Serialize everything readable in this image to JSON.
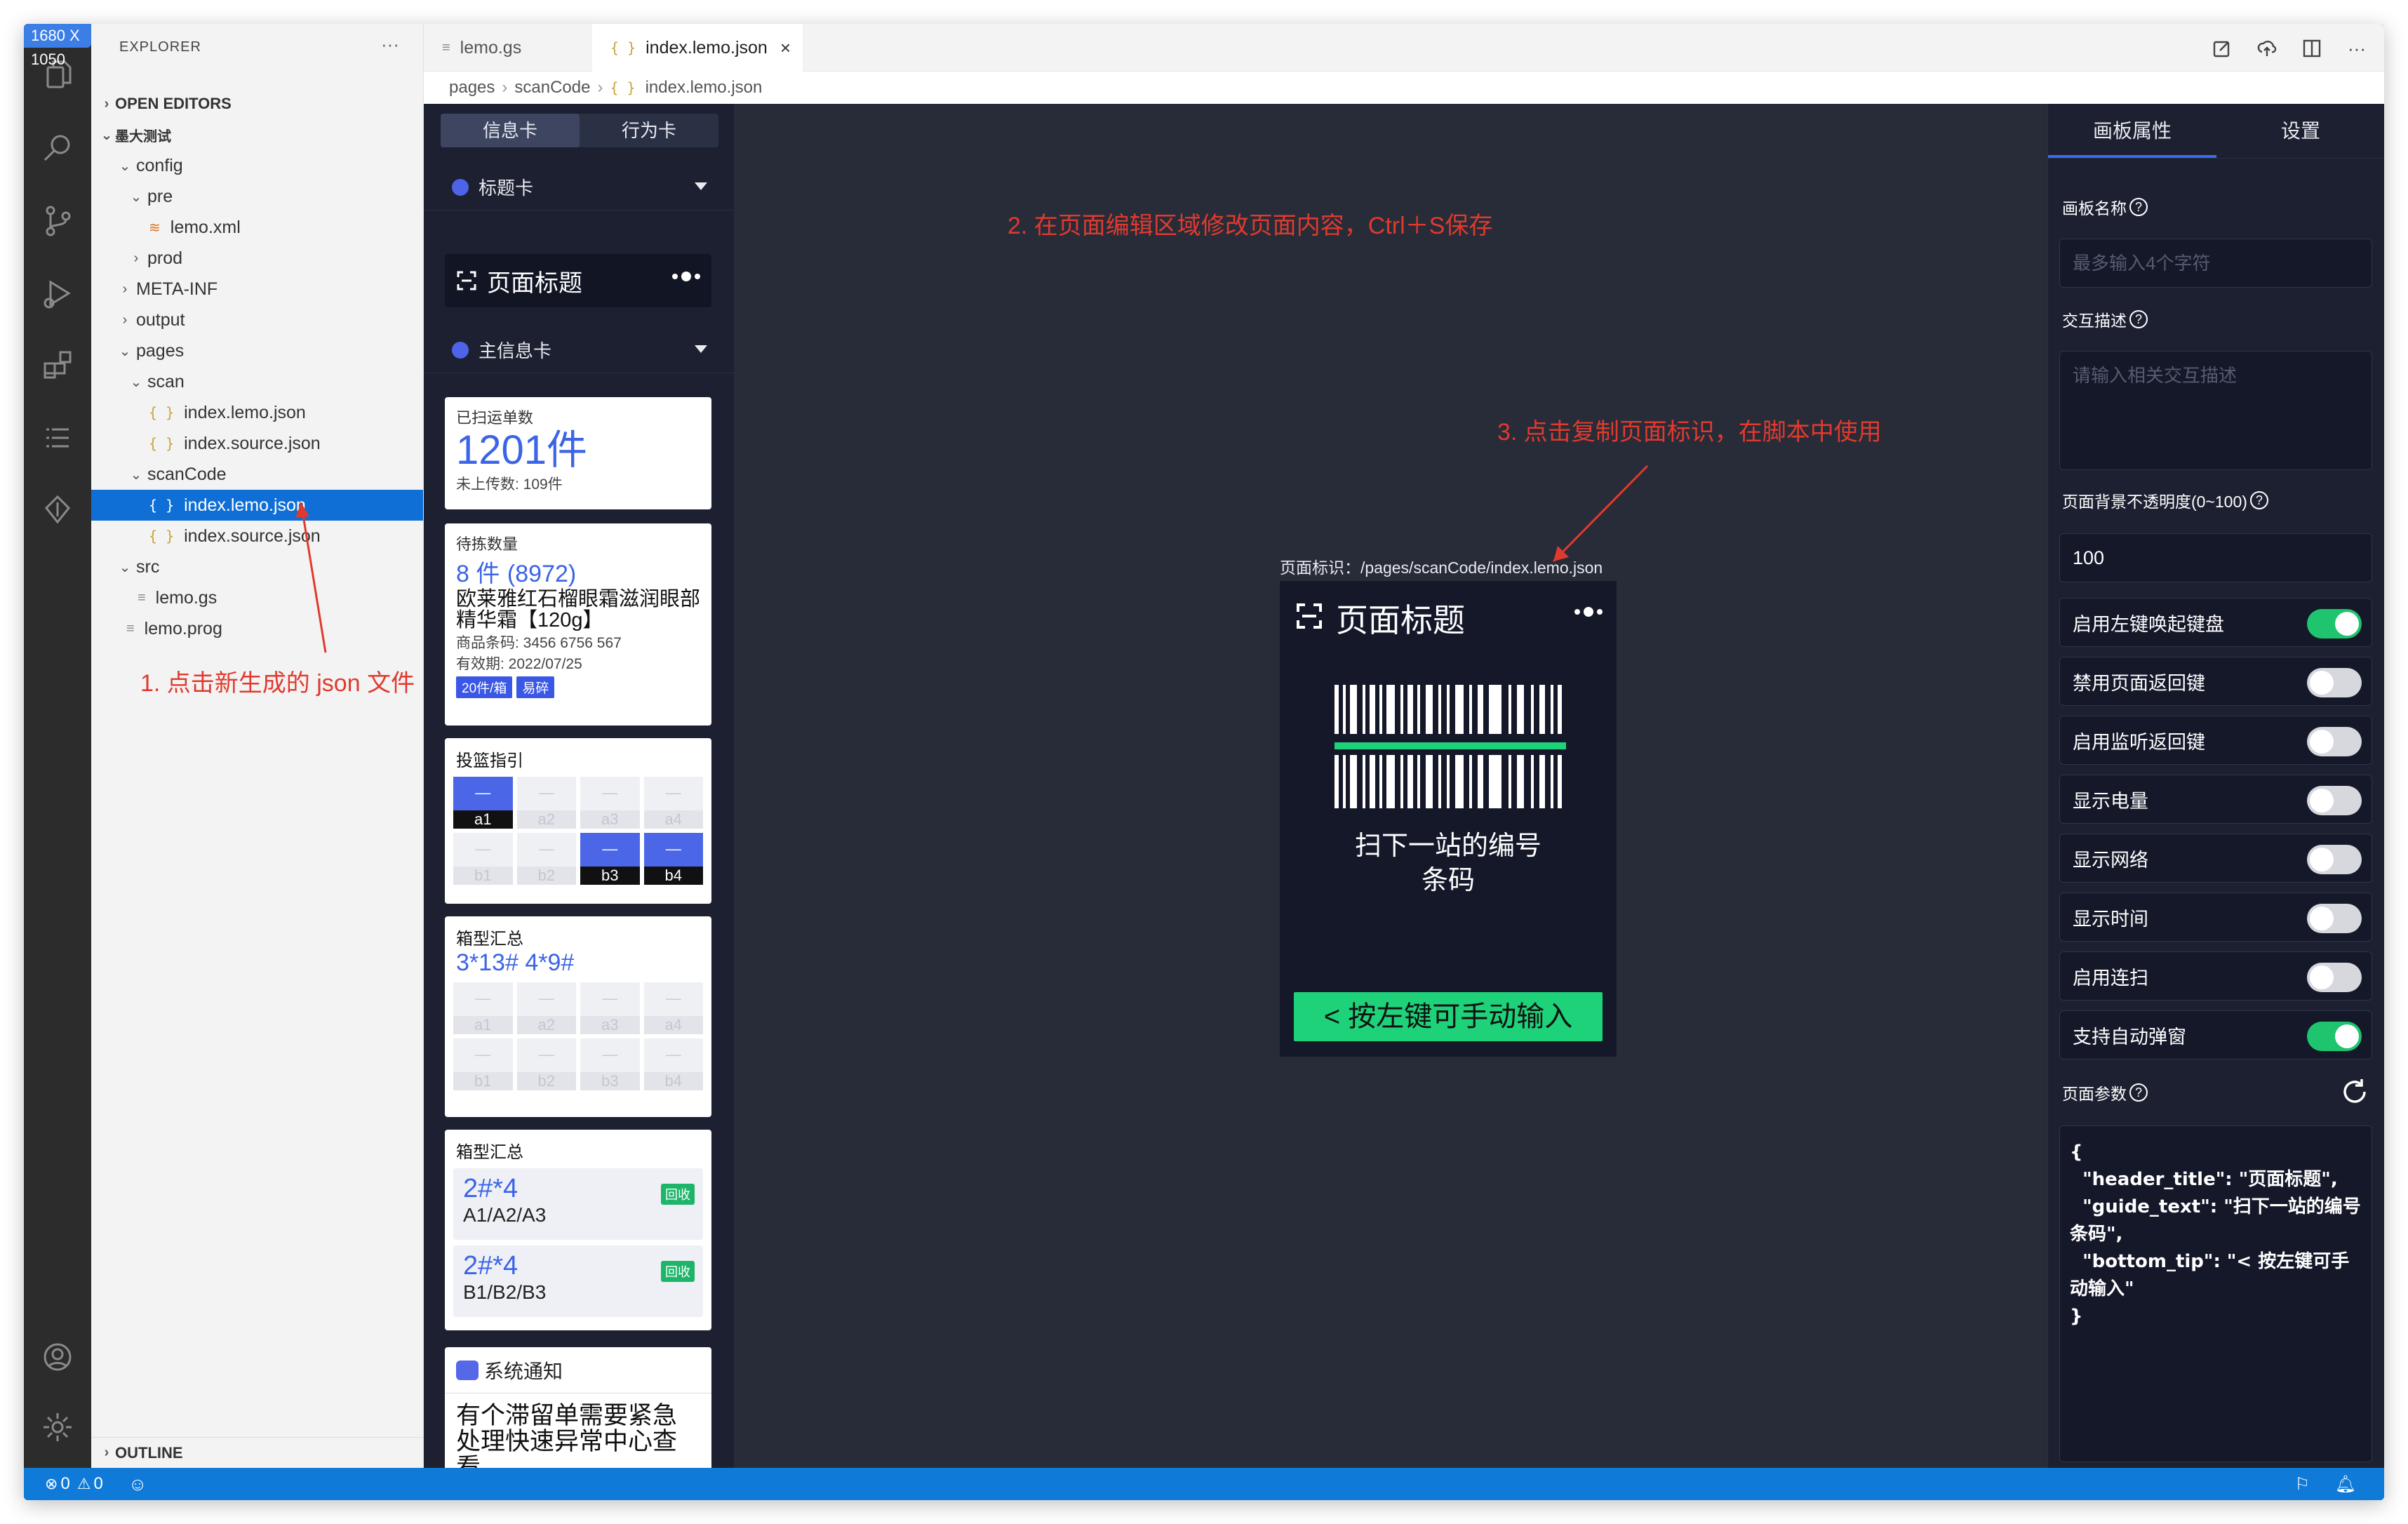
{
  "size_badge": "1680 X 1050",
  "explorer": {
    "title": "EXPLORER",
    "more": "···",
    "open_editors": "OPEN EDITORS",
    "project": "墨大测试",
    "outline": "OUTLINE",
    "tree": [
      {
        "label": "config",
        "type": "folder",
        "open": true
      },
      {
        "label": "pre",
        "type": "folder",
        "open": true
      },
      {
        "label": "lemo.xml",
        "type": "xml"
      },
      {
        "label": "prod",
        "type": "folder",
        "open": false
      },
      {
        "label": "META-INF",
        "type": "folder",
        "open": false
      },
      {
        "label": "output",
        "type": "folder",
        "open": false
      },
      {
        "label": "pages",
        "type": "folder",
        "open": true
      },
      {
        "label": "scan",
        "type": "folder",
        "open": true
      },
      {
        "label": "index.lemo.json",
        "type": "json"
      },
      {
        "label": "index.source.json",
        "type": "json"
      },
      {
        "label": "scanCode",
        "type": "folder",
        "open": true
      },
      {
        "label": "index.lemo.json",
        "type": "json",
        "selected": true
      },
      {
        "label": "index.source.json",
        "type": "json"
      },
      {
        "label": "src",
        "type": "folder",
        "open": true
      },
      {
        "label": "lemo.gs",
        "type": "gs"
      },
      {
        "label": "lemo.prog",
        "type": "gs"
      }
    ]
  },
  "tabs": {
    "tab1": "lemo.gs",
    "tab2": "index.lemo.json",
    "json_glyph": "{ }",
    "close": "×"
  },
  "breadcrumb": {
    "p1": "pages",
    "p2": "scanCode",
    "p3": "index.lemo.json"
  },
  "components": {
    "seg_info": "信息卡",
    "seg_action": "行为卡",
    "group_title": "标题卡",
    "title_card_text": "页面标题",
    "group_main": "主信息卡",
    "card1": {
      "label": "已扫运单数",
      "value": "1201件",
      "sub": "未上传数: 109件"
    },
    "card2": {
      "label": "待拣数量",
      "value": "8 件",
      "value_sub": "(8972)",
      "name": "欧莱雅红石榴眼霜滋润眼部精华霜【120g】",
      "barcode": "商品条码: 3456 6756 567",
      "expiry": "有效期: 2022/07/25",
      "tag1": "20件/箱",
      "tag2": "易碎"
    },
    "card3": {
      "label": "投篮指引",
      "cells_top": [
        "a1",
        "a2",
        "a3",
        "a4"
      ],
      "cells_bottom": [
        "b1",
        "b2",
        "b3",
        "b4"
      ],
      "dash": "—"
    },
    "card4": {
      "label": "箱型汇总",
      "value": "3*13# 4*9#",
      "cells_top": [
        "a1",
        "a2",
        "a3",
        "a4"
      ],
      "cells_bottom": [
        "b1",
        "b2",
        "b3",
        "b4"
      ]
    },
    "card5": {
      "label": "箱型汇总",
      "item1_value": "2#*4",
      "item1_loc": "A1/A2/A3",
      "item2_value": "2#*4",
      "item2_loc": "B1/B2/B3",
      "recycle": "回收"
    },
    "card6": {
      "title": "系统通知",
      "body": "有个滞留单需要紧急处理快速异常中心查看。"
    }
  },
  "canvas": {
    "anno1": "1. 点击新生成的 json 文件",
    "anno2": "2. 在页面编辑区域修改页面内容，Ctrl＋S保存",
    "anno3": "3. 点击复制页面标识，在脚本中使用",
    "page_id": "页面标识：/pages/scanCode/index.lemo.json",
    "phone_title": "页面标题",
    "guide": "扫下一站的编号条码",
    "bottom_tip": "< 按左键可手动输入",
    "annotation_color": "#e03a2e"
  },
  "props": {
    "tab_canvas": "画板属性",
    "tab_settings": "设置",
    "name_label": "画板名称",
    "name_placeholder": "最多输入4个字符",
    "desc_label": "交互描述",
    "desc_placeholder": "请输入相关交互描述",
    "opacity_label": "页面背景不透明度(0~100)",
    "opacity_value": "100",
    "toggles": [
      {
        "label": "启用左键唤起键盘",
        "on": true
      },
      {
        "label": "禁用页面返回键",
        "on": false
      },
      {
        "label": "启用监听返回键",
        "on": false
      },
      {
        "label": "显示电量",
        "on": false
      },
      {
        "label": "显示网络",
        "on": false
      },
      {
        "label": "显示时间",
        "on": false
      },
      {
        "label": "启用连扫",
        "on": false
      },
      {
        "label": "支持自动弹窗",
        "on": true
      }
    ],
    "params_label": "页面参数",
    "params_json": "{\n  \"header_title\": \"页面标题\",\n  \"guide_text\": \"扫下一站的编号条码\",\n  \"bottom_tip\": \"< 按左键可手动输入\"\n}",
    "qmark": "?"
  },
  "status": {
    "errors": "0",
    "warnings": "0"
  }
}
